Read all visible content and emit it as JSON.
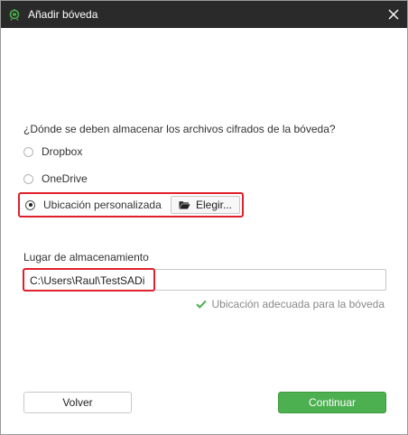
{
  "window": {
    "title": "Añadir bóveda"
  },
  "location": {
    "question": "¿Dónde se deben almacenar los archivos cifrados de la bóveda?",
    "options": [
      {
        "label": "Dropbox",
        "selected": false
      },
      {
        "label": "OneDrive",
        "selected": false
      },
      {
        "label": "Ubicación personalizada",
        "selected": true
      }
    ],
    "choose_label": "Elegir..."
  },
  "storage": {
    "label": "Lugar de almacenamiento",
    "path": "C:\\Users\\Raul\\TestSADi",
    "status": "Ubicación adecuada para la bóveda"
  },
  "footer": {
    "back_label": "Volver",
    "continue_label": "Continuar"
  },
  "colors": {
    "titlebar": "#2a2a2a",
    "highlight": "#e0202c",
    "accent_green": "#4caf50"
  },
  "icons": {
    "app": "cryptomator-robot-icon",
    "close": "close-icon",
    "folder": "folder-open-icon",
    "check": "check-icon"
  }
}
